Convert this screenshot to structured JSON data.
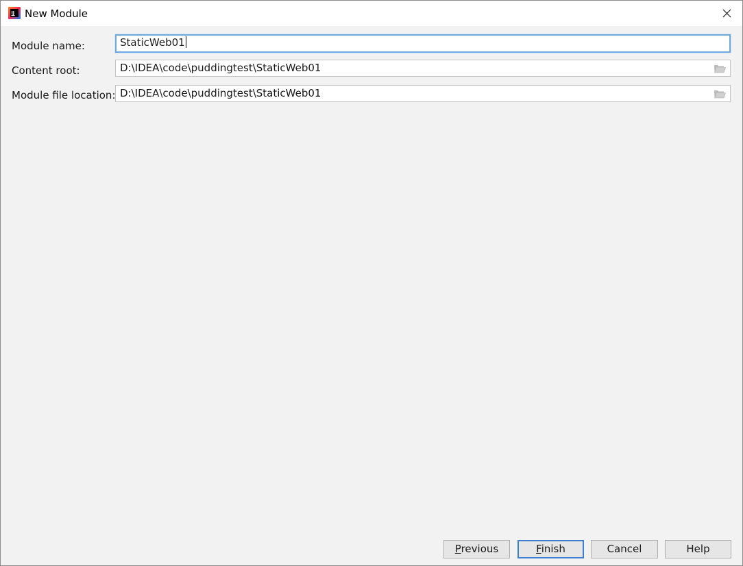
{
  "window": {
    "title": "New Module",
    "icon": "intellij-idea-icon"
  },
  "form": {
    "module_name": {
      "label": "Module name:",
      "value": "StaticWeb01"
    },
    "content_root": {
      "label": "Content root:",
      "value": "D:\\IDEA\\code\\puddingtest\\StaticWeb01",
      "icon": "folder-open-icon"
    },
    "module_file_location": {
      "label": "Module file location:",
      "value": "D:\\IDEA\\code\\puddingtest\\StaticWeb01",
      "icon": "folder-open-icon"
    }
  },
  "buttons": {
    "previous": {
      "mnemonic": "P",
      "rest": "revious"
    },
    "finish": {
      "mnemonic": "F",
      "rest": "inish"
    },
    "cancel": "Cancel",
    "help": "Help"
  },
  "colors": {
    "focus_border": "#6fa8dc",
    "default_button_border": "#3c7fd1",
    "dialog_background": "#f2f2f2"
  }
}
